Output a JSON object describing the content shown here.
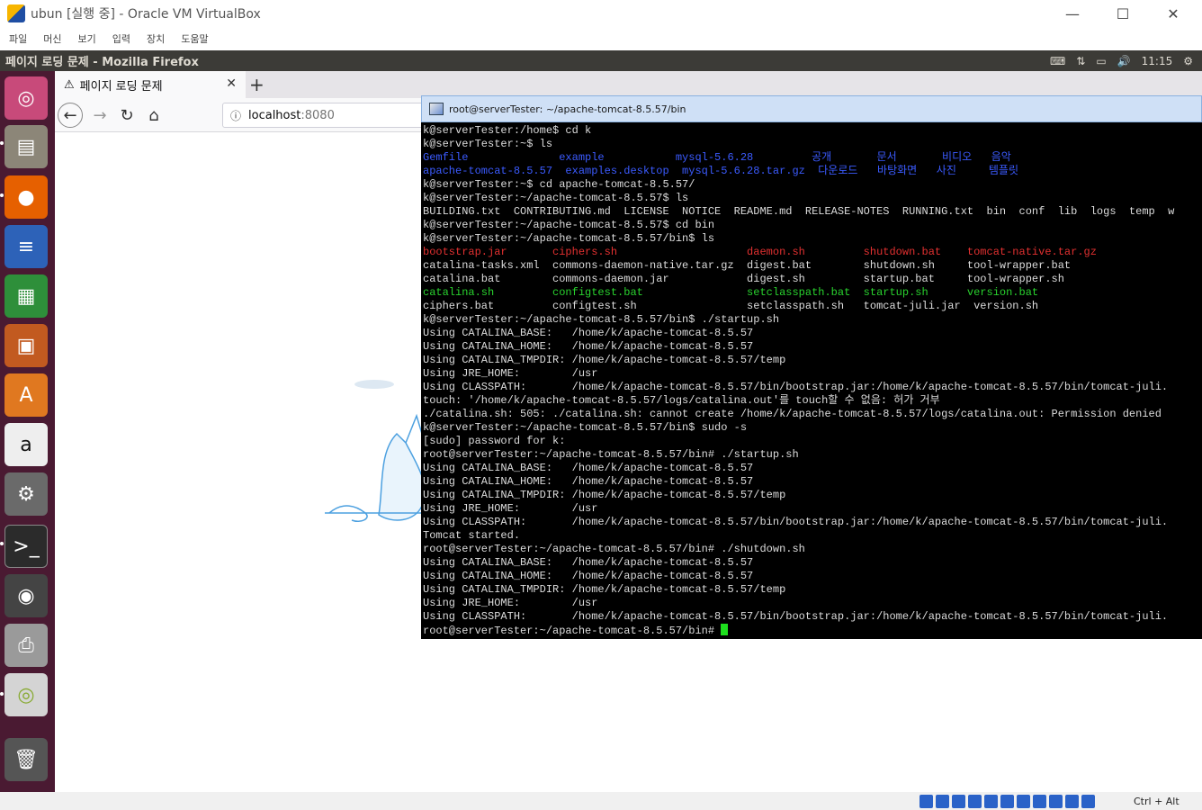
{
  "host": {
    "title": "ubun [실행 중] - Oracle VM VirtualBox",
    "menu": [
      "파일",
      "머신",
      "보기",
      "입력",
      "장치",
      "도움말"
    ],
    "host_key": "Ctrl + Alt"
  },
  "panel": {
    "window_title": "페이지 로딩 문제 - Mozilla Firefox",
    "time": "11:15"
  },
  "launcher": {
    "items": [
      "ubuntu-dash-icon",
      "files-icon",
      "firefox-icon",
      "writer-icon",
      "calc-icon",
      "impress-icon",
      "software-center-icon",
      "amazon-icon",
      "system-settings-icon",
      "terminal-icon",
      "disk-icon",
      "printer-icon",
      "dvd-icon",
      "trash-icon"
    ]
  },
  "firefox": {
    "tab_title": "페이지 로딩 문제",
    "url_host": "localhost",
    "url_port": ":8080"
  },
  "terminal": {
    "title": "root@serverTester: ~/apache-tomcat-8.5.57/bin",
    "lines": [
      "k@serverTester:/home$ cd k",
      "k@serverTester:~$ ls",
      "Gemfile              example           mysql-5.6.28         공개       문서       비디오   음악",
      "apache-tomcat-8.5.57  examples.desktop  mysql-5.6.28.tar.gz  다운로드   바탕화면   사진     템플릿",
      "k@serverTester:~$ cd apache-tomcat-8.5.57/",
      "k@serverTester:~/apache-tomcat-8.5.57$ ls",
      "BUILDING.txt  CONTRIBUTING.md  LICENSE  NOTICE  README.md  RELEASE-NOTES  RUNNING.txt  bin  conf  lib  logs  temp  w",
      "k@serverTester:~/apache-tomcat-8.5.57$ cd bin",
      "k@serverTester:~/apache-tomcat-8.5.57/bin$ ls",
      "bootstrap.jar       ciphers.sh                    daemon.sh         shutdown.bat    tomcat-native.tar.gz",
      "catalina-tasks.xml  commons-daemon-native.tar.gz  digest.bat        shutdown.sh     tool-wrapper.bat",
      "catalina.bat        commons-daemon.jar            digest.sh         startup.bat     tool-wrapper.sh",
      "catalina.sh         configtest.bat                setclasspath.bat  startup.sh      version.bat",
      "ciphers.bat         configtest.sh                 setclasspath.sh   tomcat-juli.jar  version.sh",
      "k@serverTester:~/apache-tomcat-8.5.57/bin$ ./startup.sh",
      "Using CATALINA_BASE:   /home/k/apache-tomcat-8.5.57",
      "Using CATALINA_HOME:   /home/k/apache-tomcat-8.5.57",
      "Using CATALINA_TMPDIR: /home/k/apache-tomcat-8.5.57/temp",
      "Using JRE_HOME:        /usr",
      "Using CLASSPATH:       /home/k/apache-tomcat-8.5.57/bin/bootstrap.jar:/home/k/apache-tomcat-8.5.57/bin/tomcat-juli.",
      "touch: '/home/k/apache-tomcat-8.5.57/logs/catalina.out'를 touch할 수 없음: 허가 거부",
      "./catalina.sh: 505: ./catalina.sh: cannot create /home/k/apache-tomcat-8.5.57/logs/catalina.out: Permission denied",
      "k@serverTester:~/apache-tomcat-8.5.57/bin$ sudo -s",
      "[sudo] password for k:",
      "root@serverTester:~/apache-tomcat-8.5.57/bin# ./startup.sh",
      "Using CATALINA_BASE:   /home/k/apache-tomcat-8.5.57",
      "Using CATALINA_HOME:   /home/k/apache-tomcat-8.5.57",
      "Using CATALINA_TMPDIR: /home/k/apache-tomcat-8.5.57/temp",
      "Using JRE_HOME:        /usr",
      "Using CLASSPATH:       /home/k/apache-tomcat-8.5.57/bin/bootstrap.jar:/home/k/apache-tomcat-8.5.57/bin/tomcat-juli.",
      "Tomcat started.",
      "root@serverTester:~/apache-tomcat-8.5.57/bin# ./shutdown.sh",
      "Using CATALINA_BASE:   /home/k/apache-tomcat-8.5.57",
      "Using CATALINA_HOME:   /home/k/apache-tomcat-8.5.57",
      "Using CATALINA_TMPDIR: /home/k/apache-tomcat-8.5.57/temp",
      "Using JRE_HOME:        /usr",
      "Using CLASSPATH:       /home/k/apache-tomcat-8.5.57/bin/bootstrap.jar:/home/k/apache-tomcat-8.5.57/bin/tomcat-juli.",
      "root@serverTester:~/apache-tomcat-8.5.57/bin# "
    ]
  }
}
